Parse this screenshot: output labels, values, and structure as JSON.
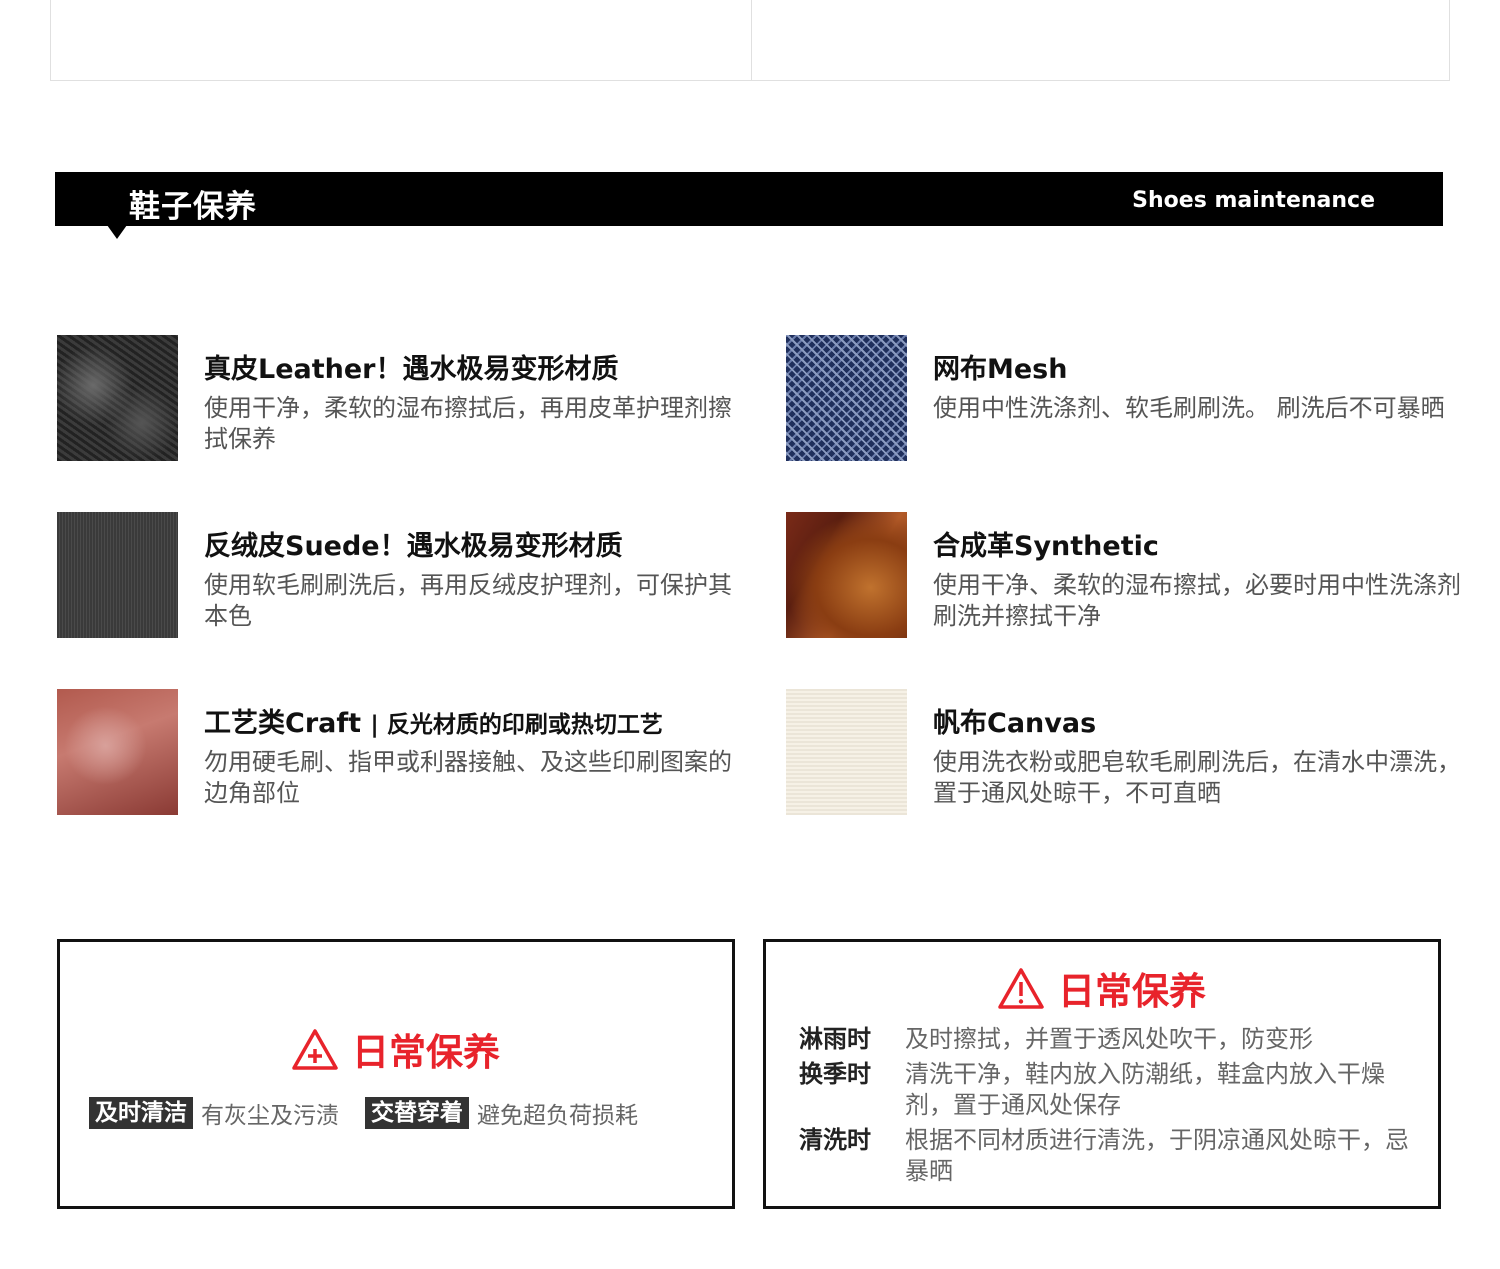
{
  "section": {
    "title_cn": "鞋子保养",
    "title_en": "Shoes maintenance"
  },
  "materials": [
    {
      "icon": "leather-swatch",
      "title": "真皮Leather！遇水极易变形材质",
      "subtitle": "",
      "desc": "使用干净，柔软的湿布擦拭后，再用皮革护理剂擦拭保养"
    },
    {
      "icon": "mesh-swatch",
      "title": "网布Mesh",
      "subtitle": "",
      "desc": "使用中性洗涤剂、软毛刷刷洗。 刷洗后不可暴晒"
    },
    {
      "icon": "suede-swatch",
      "title": "反绒皮Suede！遇水极易变形材质",
      "subtitle": "",
      "desc": "使用软毛刷刷洗后，再用反绒皮护理剂，可保护其本色"
    },
    {
      "icon": "synthetic-swatch",
      "title": "合成革Synthetic",
      "subtitle": "",
      "desc": "使用干净、柔软的湿布擦拭，必要时用中性洗涤剂刷洗并擦拭干净"
    },
    {
      "icon": "craft-swatch",
      "title": "工艺类Craft",
      "subtitle": "| 反光材质的印刷或热切工艺",
      "desc": "勿用硬毛刷、指甲或利器接触、及这些印刷图案的边角部位"
    },
    {
      "icon": "canvas-swatch",
      "title": "帆布Canvas",
      "subtitle": "",
      "desc": "使用洗衣粉或肥皂软毛刷刷洗后，在清水中漂洗，置于通风处晾干，不可直晒"
    }
  ],
  "daily_left": {
    "title": "日常保养",
    "tags": [
      {
        "label": "及时清洁",
        "text": "有灰尘及污渍"
      },
      {
        "label": "交替穿着",
        "text": "避免超负荷损耗"
      }
    ]
  },
  "daily_right": {
    "title": "日常保养",
    "tips": [
      {
        "label": "淋雨时",
        "text": "及时擦拭，并置于透风处吹干，防变形"
      },
      {
        "label": "换季时",
        "text": "清洗干净，鞋内放入防潮纸，鞋盒内放入干燥剂，置于通风处保存"
      },
      {
        "label": "清洗时",
        "text": "根据不同材质进行清洗，于阴凉通风处晾干，忌暴晒"
      }
    ]
  },
  "colors": {
    "warning_red": "#e8232b",
    "header_bg": "#000000",
    "tag_bg": "#333333"
  }
}
